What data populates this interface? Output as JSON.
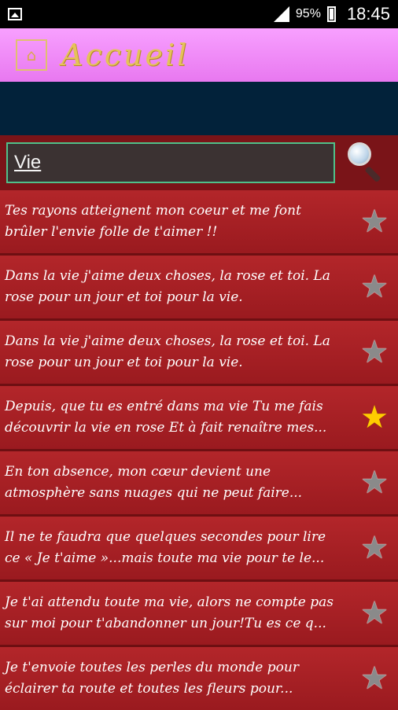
{
  "status": {
    "battery": "95%",
    "time": "18:45"
  },
  "header": {
    "title": "Accueil",
    "home_glyph": "⌂"
  },
  "search": {
    "value": "Vie"
  },
  "quotes": [
    {
      "text": "Tes rayons atteignent mon coeur et me font brûler l'envie folle de t'aimer !!",
      "favorite": false
    },
    {
      "text": "Dans la vie j'aime deux choses, la rose et toi. La rose pour un jour et toi pour la vie.",
      "favorite": false
    },
    {
      "text": "Dans la vie j'aime deux choses, la rose et toi. La rose pour un jour et toi pour la vie.",
      "favorite": false
    },
    {
      "text": "Depuis, que tu es entré dans ma vie Tu me fais découvrir la vie en rose Et à fait renaître mes...",
      "favorite": true
    },
    {
      "text": "En ton absence, mon cœur devient une atmosphère sans nuages qui ne peut faire...",
      "favorite": false
    },
    {
      "text": "Il ne te faudra que quelques secondes pour lire ce « Je t'aime »...mais toute ma vie pour te le...",
      "favorite": false
    },
    {
      "text": "Je t'ai attendu toute ma vie, alors ne compte pas sur moi pour t'abandonner un jour!Tu es ce q...",
      "favorite": false
    },
    {
      "text": "Je t'envoie toutes les perles du monde pour éclairer ta route et toutes les fleurs pour...",
      "favorite": false
    }
  ],
  "icons": {
    "star": "★"
  },
  "colors": {
    "accent": "#50c18a",
    "favorite": "#ffcc00",
    "item_bg": "#b3262a"
  }
}
